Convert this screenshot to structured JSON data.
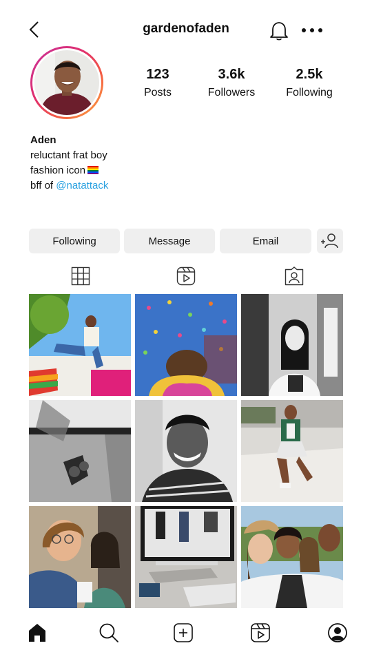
{
  "header": {
    "username": "gardenofaden",
    "back_icon": "chevron-left-icon",
    "notifications_icon": "bell-icon",
    "more_icon": "more-horizontal-icon"
  },
  "profile": {
    "avatar_icon": "profile-photo",
    "stats": {
      "posts": {
        "value": "123",
        "label": "Posts"
      },
      "followers": {
        "value": "3.6k",
        "label": "Followers"
      },
      "following": {
        "value": "2.5k",
        "label": "Following"
      }
    },
    "bio": {
      "name": "Aden",
      "line1": "reluctant frat boy",
      "line2": "fashion icon",
      "line3_prefix": "bff of",
      "line3_mention": "@natattack"
    }
  },
  "actions": {
    "following_label": "Following",
    "message_label": "Message",
    "email_label": "Email",
    "add_user_icon": "add-user-icon"
  },
  "tabs": [
    "grid-icon",
    "reels-icon",
    "tagged-icon"
  ],
  "colors": {
    "link": "#2aa1e0",
    "button_bg": "#efefef",
    "story_ring": [
      "#c7339d",
      "#e1306c",
      "#f56040",
      "#fcaf45"
    ]
  },
  "bottom_nav": [
    "home-icon",
    "search-icon",
    "create-icon",
    "reels-icon",
    "profile-icon"
  ]
}
